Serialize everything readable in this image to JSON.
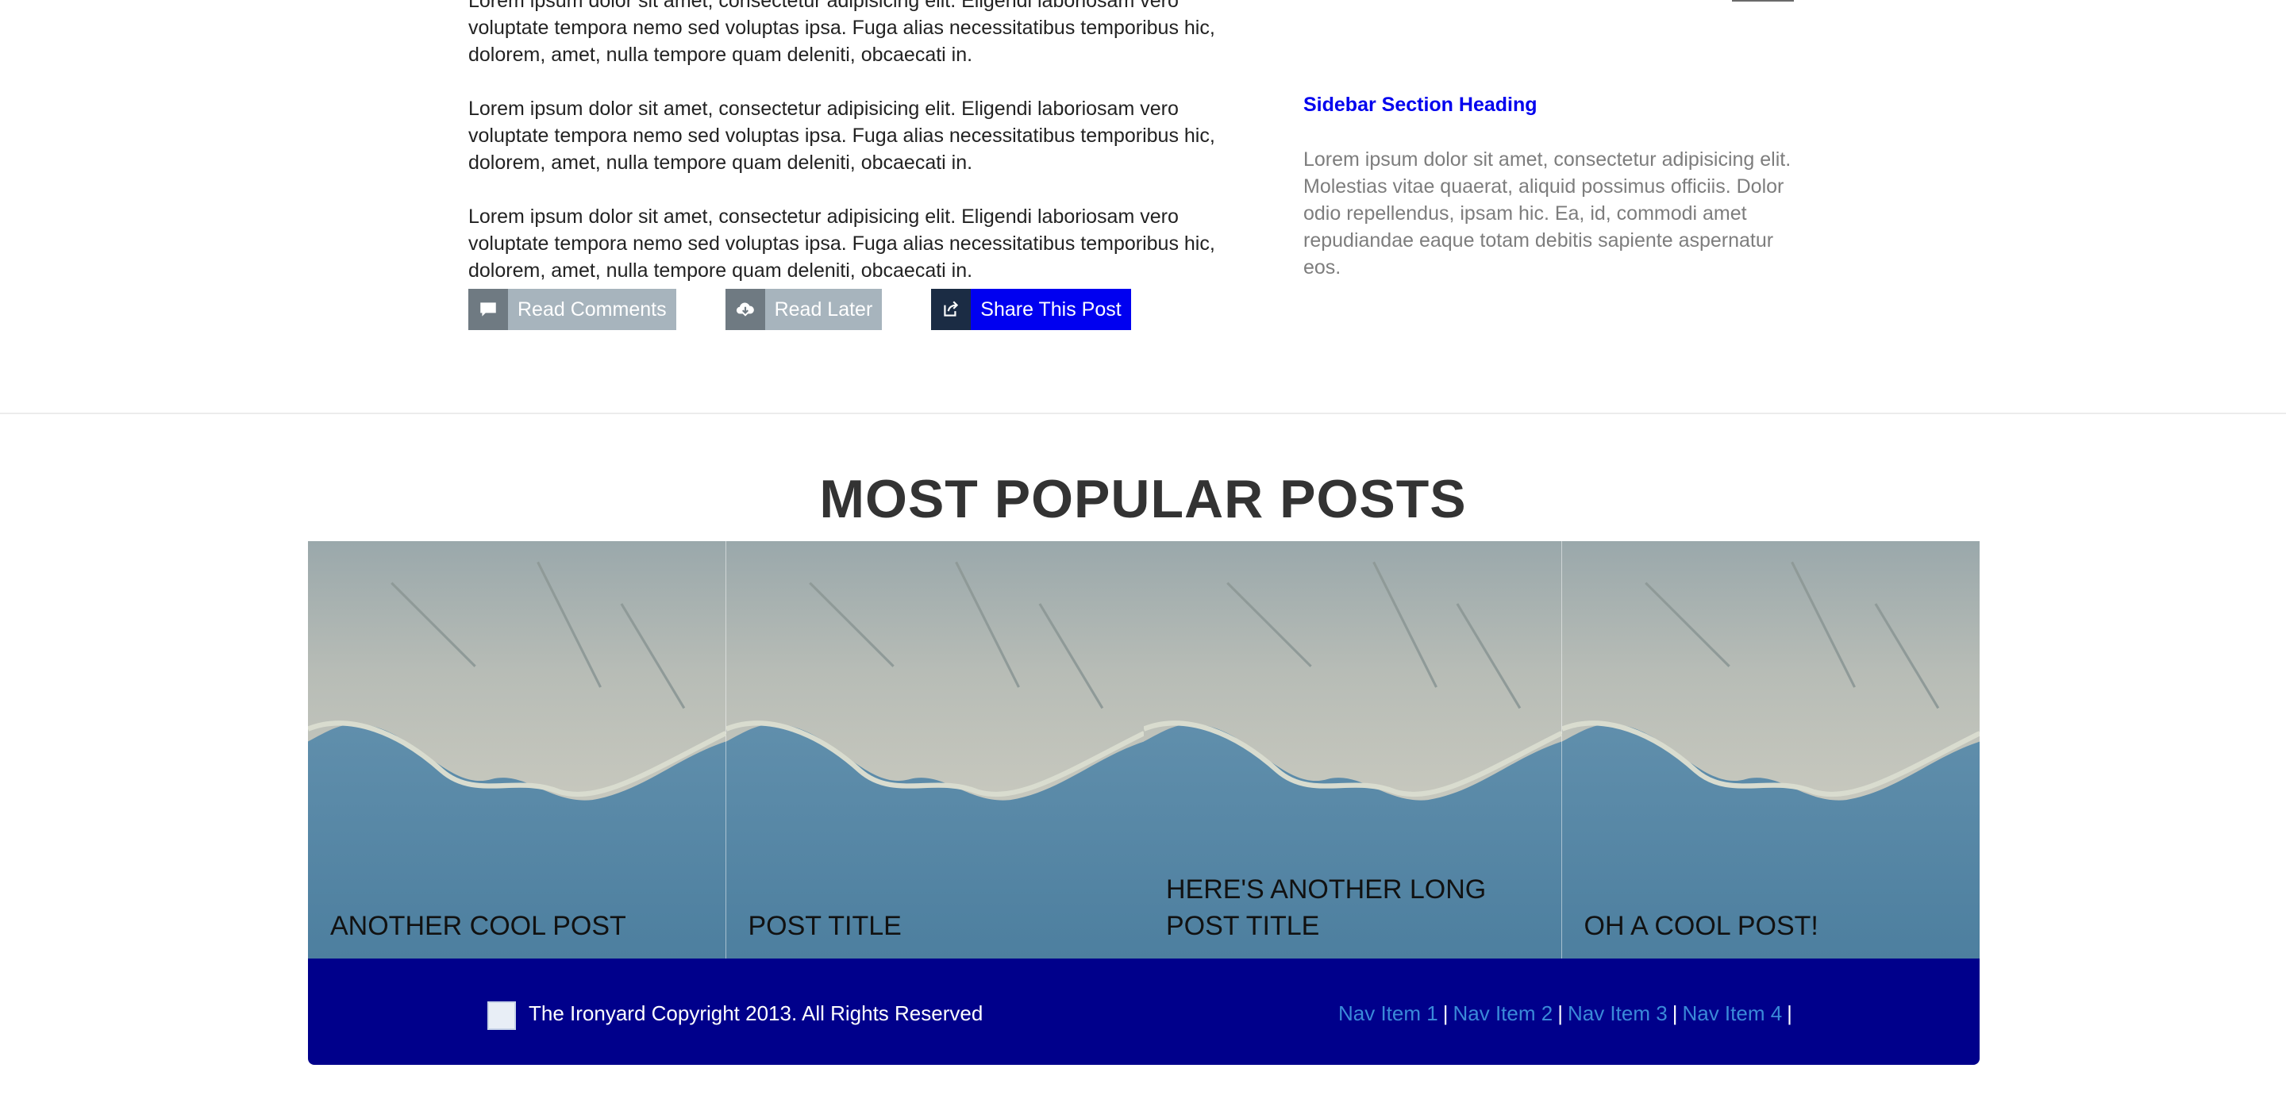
{
  "article": {
    "paragraphs": [
      "Lorem ipsum dolor sit amet, consectetur adipisicing elit. Eligendi laboriosam vero voluptate tempora nemo sed voluptas ipsa. Fuga alias necessitatibus temporibus hic, dolorem, amet, nulla tempore quam deleniti, obcaecati in.",
      "Lorem ipsum dolor sit amet, consectetur adipisicing elit. Eligendi laboriosam vero voluptate tempora nemo sed voluptas ipsa. Fuga alias necessitatibus temporibus hic, dolorem, amet, nulla tempore quam deleniti, obcaecati in.",
      "Lorem ipsum dolor sit amet, consectetur adipisicing elit. Eligendi laboriosam vero voluptate tempora nemo sed voluptas ipsa. Fuga alias necessitatibus temporibus hic, dolorem, amet, nulla tempore quam deleniti, obcaecati in."
    ],
    "buttons": {
      "read_comments": "Read Comments",
      "read_later": "Read Later",
      "share": "Share This Post"
    }
  },
  "sidebar": {
    "heading": "Sidebar Section Heading",
    "text": "Lorem ipsum dolor sit amet, consectetur adipisicing elit. Molestias vitae quaerat, aliquid possimus officiis. Dolor odio repellendus, ipsam hic. Ea, id, commodi amet repudiandae eaque totam debitis sapiente aspernatur eos."
  },
  "popular": {
    "title": "MOST POPULAR POSTS",
    "posts": [
      {
        "title": "ANOTHER COOL POST"
      },
      {
        "title": "POST TITLE"
      },
      {
        "title": "HERE'S ANOTHER LONG POST TITLE"
      },
      {
        "title": "OH A COOL POST!"
      }
    ]
  },
  "footer": {
    "copyright": "The Ironyard Copyright 2013. All Rights Reserved",
    "nav": [
      "Nav Item 1",
      "Nav Item 2",
      "Nav Item 3",
      "Nav Item 4"
    ],
    "separator": "|"
  },
  "colors": {
    "link_blue": "#0000ee",
    "share_button": "#0000f0",
    "footer_bg": "#00008b",
    "footer_link": "#3a8ad8",
    "button_gray": "#a7b4bd"
  }
}
